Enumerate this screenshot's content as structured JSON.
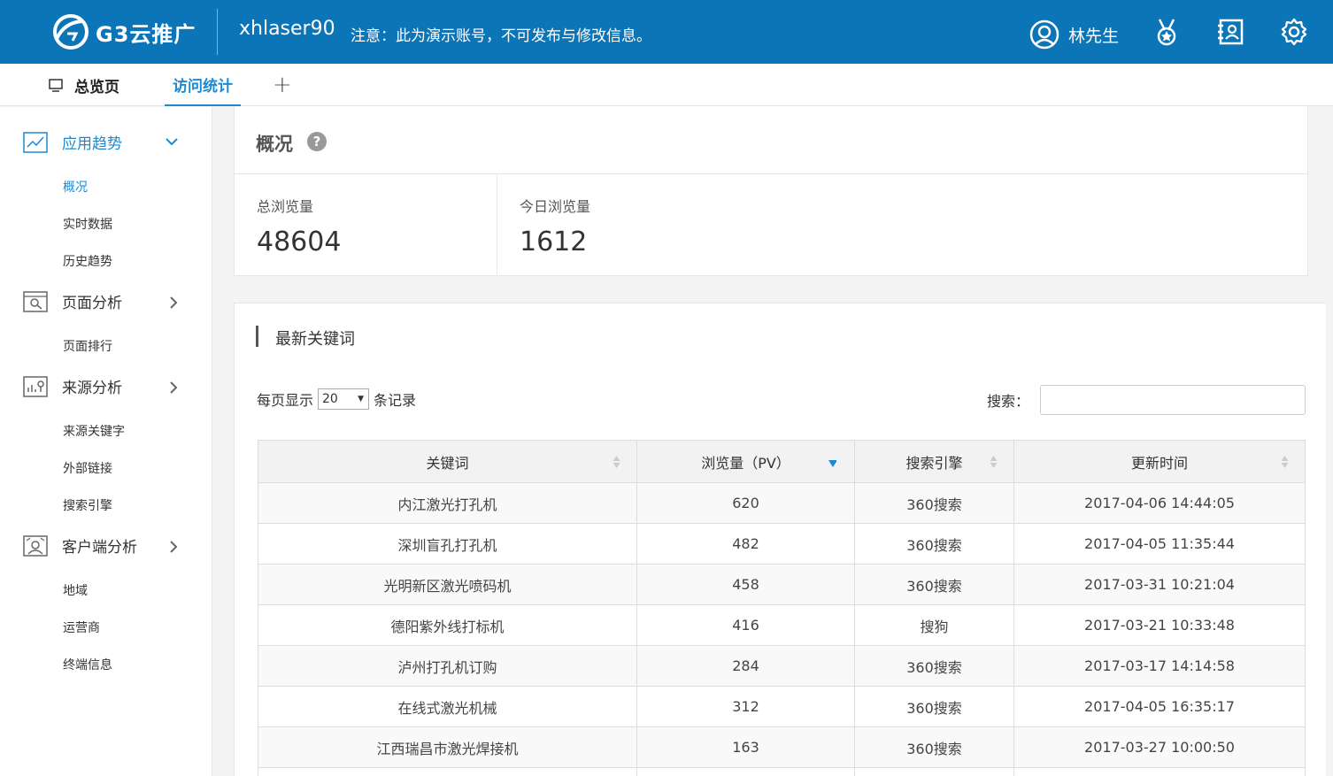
{
  "header": {
    "logo_text": "G3云推广",
    "account": "xhlaser90",
    "notice": "注意：此为演示账号，不可发布与修改信息。",
    "user_name": "林先生"
  },
  "tabs": {
    "overview": "总览页",
    "stats": "访问统计",
    "add": "+"
  },
  "sidebar": {
    "groups": [
      {
        "label": "应用趋势",
        "items": [
          "概况",
          "实时数据",
          "历史趋势"
        ]
      },
      {
        "label": "页面分析",
        "items": [
          "页面排行"
        ]
      },
      {
        "label": "来源分析",
        "items": [
          "来源关键字",
          "外部链接",
          "搜索引擎"
        ]
      },
      {
        "label": "客户端分析",
        "items": [
          "地域",
          "运营商",
          "终端信息"
        ]
      }
    ]
  },
  "overview": {
    "title": "概况",
    "help": "?",
    "total_label": "总浏览量",
    "total_value": "48604",
    "today_label": "今日浏览量",
    "today_value": "1612"
  },
  "keywords": {
    "title": "最新关键词",
    "per_page_prefix": "每页显示",
    "per_page_value": "20",
    "per_page_suffix": "条记录",
    "search_label": "搜索：",
    "columns": [
      "关键词",
      "浏览量（PV）",
      "搜索引擎",
      "更新时间"
    ],
    "rows": [
      [
        "内江激光打孔机",
        "620",
        "360搜索",
        "2017-04-06 14:44:05"
      ],
      [
        "深圳盲孔打孔机",
        "482",
        "360搜索",
        "2017-04-05 11:35:44"
      ],
      [
        "光明新区激光喷码机",
        "458",
        "360搜索",
        "2017-03-31 10:21:04"
      ],
      [
        "德阳紫外线打标机",
        "416",
        "搜狗",
        "2017-03-21 10:33:48"
      ],
      [
        "泸州打孔机订购",
        "284",
        "360搜索",
        "2017-03-17 14:14:58"
      ],
      [
        "在线式激光机械",
        "312",
        "360搜索",
        "2017-04-05 16:35:17"
      ],
      [
        "江西瑞昌市激光焊接机",
        "163",
        "360搜索",
        "2017-03-27 10:00:50"
      ],
      [
        "",
        "",
        "",
        ""
      ]
    ]
  },
  "colors": {
    "brand": "#0c75b8",
    "accent": "#1a8ad4"
  }
}
